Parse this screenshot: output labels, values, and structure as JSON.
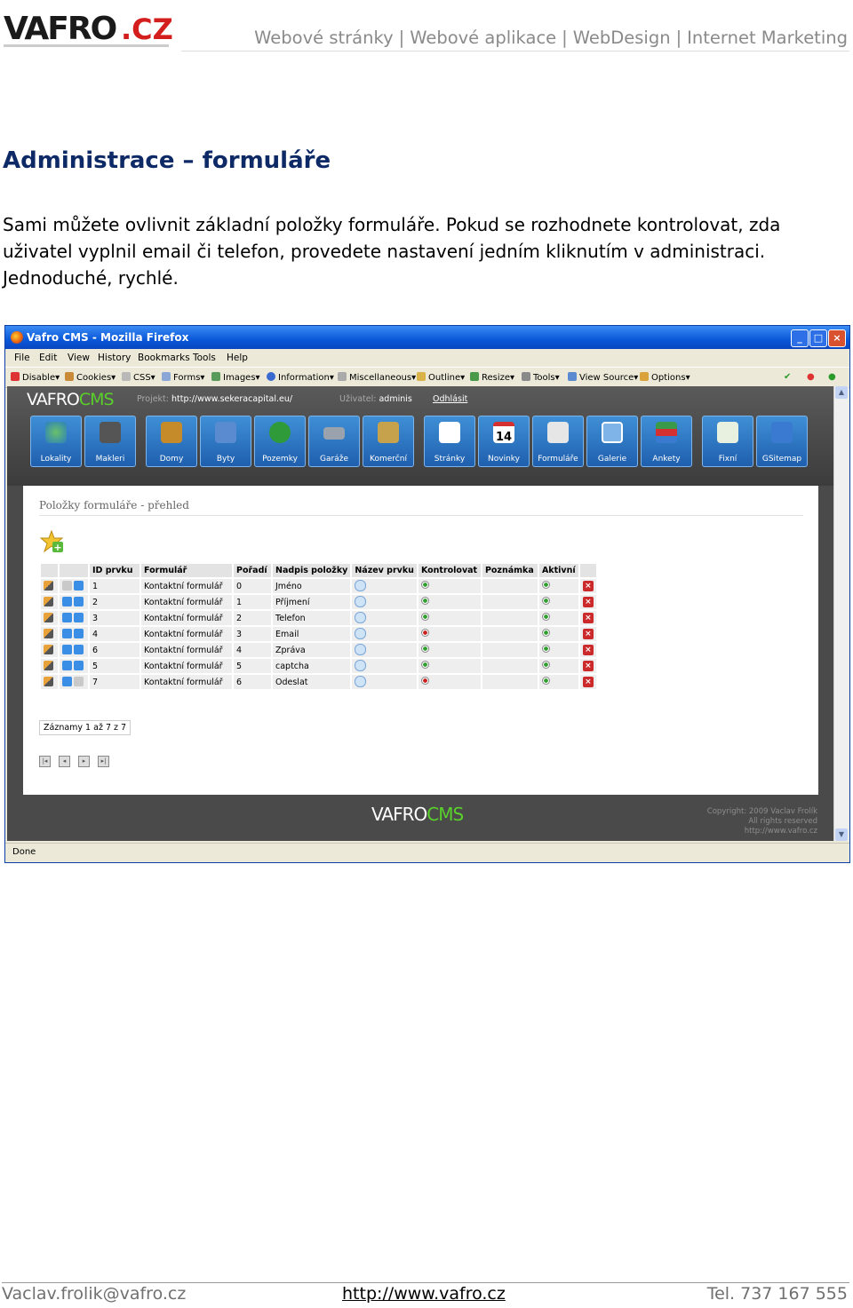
{
  "header": {
    "logo_text": "VAFRO.CZ",
    "nav": [
      "Webové stránky",
      "Webové aplikace",
      "WebDesign",
      "Internet Marketing"
    ],
    "separator": "|"
  },
  "article": {
    "title": "Administrace – formuláře",
    "intro": "Sami můžete ovlivnit základní položky formuláře. Pokud se rozhodnete kontrolovat, zda uživatel vyplnil email či telefon, provedete nastavení jedním kliknutím v administraci. Jednoduché, rychlé."
  },
  "screenshot": {
    "window_title": "Vafro CMS - Mozilla Firefox",
    "menu": [
      "File",
      "Edit",
      "View",
      "History",
      "Bookmarks",
      "Tools",
      "Help"
    ],
    "webdev_toolbar": [
      "Disable▾",
      "Cookies▾",
      "CSS▾",
      "Forms▾",
      "Images▾",
      "Information▾",
      "Miscellaneous▾",
      "Outline▾",
      "Resize▾",
      "Tools▾",
      "View Source▾",
      "Options▾"
    ],
    "status_text": "Done",
    "cms": {
      "logo_main": "VAFRO",
      "logo_accent": "CMS",
      "project_label": "Projekt:",
      "project_url": "http://www.sekeracapital.eu/",
      "user_label": "Uživatel:",
      "user_name": "adminis",
      "logout": "Odhlásit",
      "tiles": [
        "Lokality",
        "Makleri",
        "Domy",
        "Byty",
        "Pozemky",
        "Garáže",
        "Komerční",
        "Stránky",
        "Novinky",
        "Formuláře",
        "Galerie",
        "Ankety",
        "Fixní",
        "GSitemap"
      ],
      "tile_colors": [
        "#2b7fbf",
        "#555555",
        "#c58a2a",
        "#5a8bd0",
        "#2f9a3a",
        "#9aa3ad",
        "#c7a24d",
        "#ffffff",
        "#d43030",
        "#e6e6e6",
        "#7fb4e8",
        "#3a9a4a",
        "#e8f0e0",
        "#3a7ad0"
      ],
      "calendar_day": "14",
      "page_heading": "Položky formuláře - přehled",
      "table": {
        "headers": [
          "ID prvku",
          "Formulář",
          "Pořadí",
          "Nadpis položky",
          "Název prvku",
          "Kontrolovat",
          "Poznámka",
          "Aktivní"
        ],
        "rows": [
          {
            "id": "1",
            "form": "Kontaktní formulář",
            "order": "0",
            "title": "Jméno",
            "check": "green"
          },
          {
            "id": "2",
            "form": "Kontaktní formulář",
            "order": "1",
            "title": "Příjmení",
            "check": "green"
          },
          {
            "id": "3",
            "form": "Kontaktní formulář",
            "order": "2",
            "title": "Telefon",
            "check": "green"
          },
          {
            "id": "4",
            "form": "Kontaktní formulář",
            "order": "3",
            "title": "Email",
            "check": "red"
          },
          {
            "id": "6",
            "form": "Kontaktní formulář",
            "order": "4",
            "title": "Zpráva",
            "check": "green"
          },
          {
            "id": "5",
            "form": "Kontaktní formulář",
            "order": "5",
            "title": "captcha",
            "check": "green"
          },
          {
            "id": "7",
            "form": "Kontaktní formulář",
            "order": "6",
            "title": "Odeslat",
            "check": "red"
          }
        ]
      },
      "records": "Záznamy 1 až 7 z 7",
      "copyright": [
        "Copyright: 2009 Vaclav Frolík",
        "All rights reserved",
        "http://www.vafro.cz"
      ]
    }
  },
  "footer": {
    "email": "Vaclav.frolik@vafro.cz",
    "url": "http://www.vafro.cz",
    "tel": "Tel. 737 167 555"
  }
}
